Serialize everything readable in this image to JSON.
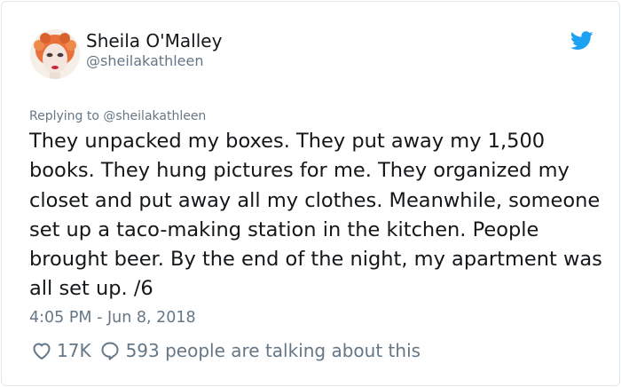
{
  "user": {
    "display_name": "Sheila O'Malley",
    "handle": "@sheilakathleen"
  },
  "tweet": {
    "reply_context": "Replying to @sheilakathleen",
    "text": "They unpacked my boxes. They put away my 1,500 books. They hung pictures for me. They organized my closet and put away all my clothes. Meanwhile, someone set up a taco-making station in the kitchen. People brought beer. By the end of the night, my apartment was all set up. /6",
    "timestamp": "4:05 PM - Jun 8, 2018"
  },
  "engagement": {
    "likes": "17K",
    "replies_text": "593 people are talking about this"
  },
  "icons": {
    "brand": "twitter-bird-icon",
    "like": "heart-icon",
    "reply": "speech-bubble-icon"
  },
  "colors": {
    "brand_blue": "#1da1f2",
    "text_primary": "#14171a",
    "text_secondary": "#657786"
  }
}
